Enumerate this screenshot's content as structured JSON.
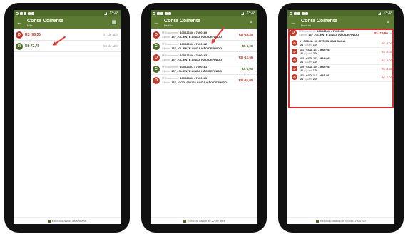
{
  "colors": {
    "appbar": "#5d7a33",
    "statusbar": "#4e6b2c",
    "debit": "#c0392b",
    "credit": "#4e6b2c",
    "highlight": "#d32f2f"
  },
  "status_bar": {
    "time": "13:48"
  },
  "screen1": {
    "title": "Conta Corrente",
    "subtitle": "Mês",
    "action_icon": "calendar-icon",
    "rows": [
      {
        "badge": "D",
        "amount": "R$ -96,36",
        "date": "27 de abril"
      },
      {
        "badge": "R",
        "amount": "R$ 72,75",
        "date": "28 de abril"
      }
    ],
    "footer": "Exibindo dados da semana"
  },
  "screen2": {
    "title": "Conta Corrente",
    "subtitle": "Pedido",
    "action_icon": "search-icon",
    "doc_prefix": "Nº Documento:",
    "client_prefix": "Cliente:",
    "rows": [
      {
        "badge": "D",
        "doc": "1000263/6 / 7000160",
        "client": "137 - CLIENTE AINDA NÃO DEFINIDO",
        "amount": "R$ -19,80"
      },
      {
        "badge": "C",
        "doc": "1000263/6 / 7000162",
        "client": "137 - CLIENTE AINDA NÃO DEFINIDO",
        "amount": "R$ 0,00"
      },
      {
        "badge": "D",
        "doc": "1000263/6 / 7000163",
        "client": "137 - CLIENTE AINDA NÃO DEFINIDO",
        "amount": "R$ -17,96"
      },
      {
        "badge": "C",
        "doc": "1000263/7 / 7000161",
        "client": "137 - CLIENTE AINDA NÃO DEFINIDO",
        "amount": "R$ 0,00"
      },
      {
        "badge": "D",
        "doc": "1000264/0 / 7000165",
        "client": "137 - COD. 001168 AINDA NÃO DEFINIDO",
        "amount": "R$ -34,00"
      }
    ],
    "footer": "Exibindo dados de 27 de abril"
  },
  "screen3": {
    "title": "Conta Corrente",
    "subtitle": "Produto",
    "action_icon": "search-icon",
    "doc_prefix": "Nº Documento:",
    "client_prefix": "Cliente:",
    "head": {
      "badge": "D",
      "doc": "1000263/6 / 7000160",
      "client": "137 - CLIENTE AINDA NÃO DEFINIDO",
      "amount": "R$ -19,80"
    },
    "qty_label": "Quant:",
    "items": [
      {
        "badge": "D",
        "title": "1 - COD. 1 - SO DIVE ON MAIS BAILA",
        "unit": "UN",
        "qty": "1,0",
        "amount": "R$ -3,00"
      },
      {
        "badge": "D",
        "title": "101 - COD. 101 - MAR 08",
        "unit": "UN",
        "qty": "2,0",
        "amount": "R$ -5,00"
      },
      {
        "badge": "D",
        "title": "103 - COD. 103 - MAR 08",
        "unit": "UN",
        "qty": "1,0",
        "amount": "R$ -5,00"
      },
      {
        "badge": "D",
        "title": "109 - COD. 109 - MAR 08",
        "unit": "UN",
        "qty": "1,0",
        "amount": "R$ -4,50"
      },
      {
        "badge": "D",
        "title": "112 - COD. 112 - MAR 08",
        "unit": "UN",
        "qty": "2,0",
        "amount": "R$ -2,00"
      }
    ],
    "footer": "Exibindo dados do pedido: 7000160"
  }
}
